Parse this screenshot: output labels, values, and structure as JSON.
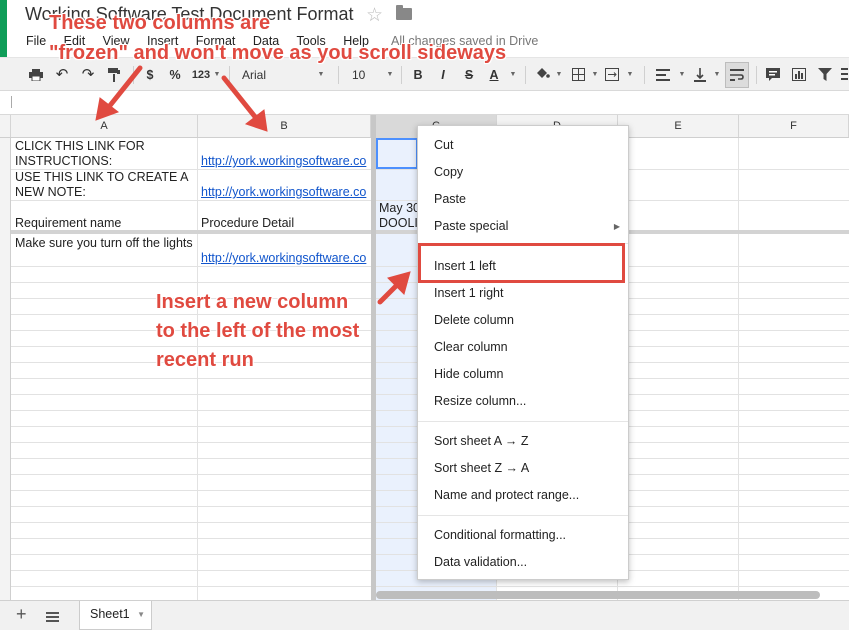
{
  "app": {
    "doc_title": "Working Software Test Document Format",
    "menu": [
      "File",
      "Edit",
      "View",
      "Insert",
      "Format",
      "Data",
      "Tools",
      "Help"
    ],
    "saved_status": "All changes saved in Drive"
  },
  "toolbar": {
    "currency": "$",
    "percent": "%",
    "number_format": "123",
    "font": "Arial",
    "font_size": "10",
    "bold": "B",
    "italic": "I",
    "strike": "S",
    "text_color": "A"
  },
  "columns": [
    "A",
    "B",
    "C",
    "D",
    "E",
    "F"
  ],
  "cells": {
    "a1": "CLICK THIS LINK FOR INSTRUCTIONS:",
    "b1": "http://york.workingsoftware.co",
    "a2": "USE THIS LINK TO CREATE A NEW NOTE:",
    "b2": "http://york.workingsoftware.co",
    "a3": "Requirement name",
    "b3": "Procedure Detail",
    "c3": "May 30",
    "c3b": "DOOLI",
    "a4": "Make sure you turn off the lights",
    "b4": "http://york.workingsoftware.co"
  },
  "context_menu": {
    "items": [
      "Cut",
      "Copy",
      "Paste",
      "Paste special",
      "Insert 1 left",
      "Insert 1 right",
      "Delete column",
      "Clear column",
      "Hide column",
      "Resize column...",
      "Sort sheet A → Z",
      "Sort sheet Z → A",
      "Name and protect range...",
      "Conditional formatting...",
      "Data validation..."
    ]
  },
  "annotations": {
    "frozen_line1": "These two columns are",
    "frozen_line2": "\"frozen\" and won't move as you scroll sideways",
    "insert_line1": "Insert a new column",
    "insert_line2": "to the left of the most",
    "insert_line3": "recent run"
  },
  "sheets": {
    "add": "+",
    "tab": "Sheet1"
  },
  "colors": {
    "annotation": "#e04a40",
    "link": "#1155cc",
    "selection": "#4d90fe"
  }
}
